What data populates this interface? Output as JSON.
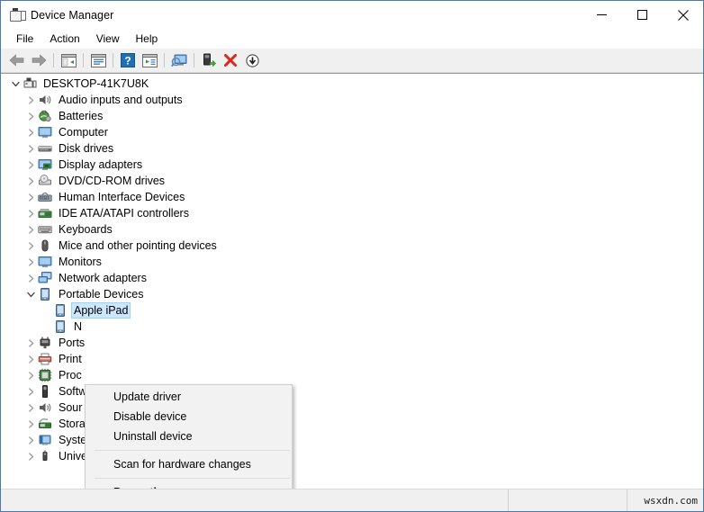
{
  "window": {
    "title": "Device Manager",
    "icon": "device-manager-icon",
    "controls": [
      {
        "name": "minimize-button",
        "glyph": "minimize"
      },
      {
        "name": "maximize-button",
        "glyph": "maximize"
      },
      {
        "name": "close-button",
        "glyph": "close"
      }
    ]
  },
  "menubar": {
    "items": [
      {
        "label": "File"
      },
      {
        "label": "Action"
      },
      {
        "label": "View"
      },
      {
        "label": "Help"
      }
    ]
  },
  "toolbar": {
    "buttons": [
      {
        "name": "back-button",
        "icon": "back-arrow-icon"
      },
      {
        "name": "forward-button",
        "icon": "forward-arrow-icon"
      },
      {
        "name": "separator-1",
        "icon": "separator"
      },
      {
        "name": "show-hide-console-tree-button",
        "icon": "console-tree-icon"
      },
      {
        "name": "separator-2",
        "icon": "separator"
      },
      {
        "name": "properties-button",
        "icon": "properties-icon"
      },
      {
        "name": "separator-3",
        "icon": "separator"
      },
      {
        "name": "help-button",
        "icon": "help-question-icon"
      },
      {
        "name": "show-window-button",
        "icon": "show-window-icon"
      },
      {
        "name": "separator-4",
        "icon": "separator"
      },
      {
        "name": "scan-hardware-changes-button",
        "icon": "scan-monitor-icon"
      },
      {
        "name": "separator-5",
        "icon": "separator"
      },
      {
        "name": "update-driver-button",
        "icon": "update-driver-icon"
      },
      {
        "name": "uninstall-device-button",
        "icon": "red-x-icon"
      },
      {
        "name": "disable-device-button",
        "icon": "down-arrow-circle-icon"
      }
    ]
  },
  "tree": {
    "root": {
      "label": "DESKTOP-41K7U8K",
      "icon": "computer-root-icon",
      "expanded": true,
      "indent": 0
    },
    "nodes": [
      {
        "label": "Audio inputs and outputs",
        "icon": "speaker-icon",
        "expanded": false,
        "indent": 1,
        "selected": false
      },
      {
        "label": "Batteries",
        "icon": "battery-icon",
        "expanded": false,
        "indent": 1,
        "selected": false
      },
      {
        "label": "Computer",
        "icon": "monitor-icon",
        "expanded": false,
        "indent": 1,
        "selected": false
      },
      {
        "label": "Disk drives",
        "icon": "disk-drive-icon",
        "expanded": false,
        "indent": 1,
        "selected": false
      },
      {
        "label": "Display adapters",
        "icon": "display-adapter-icon",
        "expanded": false,
        "indent": 1,
        "selected": false
      },
      {
        "label": "DVD/CD-ROM drives",
        "icon": "dvd-drive-icon",
        "expanded": false,
        "indent": 1,
        "selected": false
      },
      {
        "label": "Human Interface Devices",
        "icon": "hid-icon",
        "expanded": false,
        "indent": 1,
        "selected": false
      },
      {
        "label": "IDE ATA/ATAPI controllers",
        "icon": "ide-controller-icon",
        "expanded": false,
        "indent": 1,
        "selected": false
      },
      {
        "label": "Keyboards",
        "icon": "keyboard-icon",
        "expanded": false,
        "indent": 1,
        "selected": false
      },
      {
        "label": "Mice and other pointing devices",
        "icon": "mouse-icon",
        "expanded": false,
        "indent": 1,
        "selected": false
      },
      {
        "label": "Monitors",
        "icon": "monitor-icon",
        "expanded": false,
        "indent": 1,
        "selected": false
      },
      {
        "label": "Network adapters",
        "icon": "network-adapter-icon",
        "expanded": false,
        "indent": 1,
        "selected": false
      },
      {
        "label": "Portable Devices",
        "icon": "portable-device-icon",
        "expanded": true,
        "indent": 1,
        "selected": false
      },
      {
        "label": "Apple iPad",
        "icon": "portable-device-icon",
        "expanded": null,
        "indent": 2,
        "selected": true
      },
      {
        "label": "N",
        "icon": "portable-device-icon",
        "expanded": null,
        "indent": 2,
        "selected": false
      },
      {
        "label": "Ports",
        "icon": "ports-icon",
        "expanded": false,
        "indent": 1,
        "selected": false
      },
      {
        "label": "Print",
        "icon": "printer-icon",
        "expanded": false,
        "indent": 1,
        "selected": false
      },
      {
        "label": "Proc",
        "icon": "processor-icon",
        "expanded": false,
        "indent": 1,
        "selected": false
      },
      {
        "label": "Softw",
        "icon": "software-device-icon",
        "expanded": false,
        "indent": 1,
        "selected": false
      },
      {
        "label": "Sour",
        "icon": "speaker-icon",
        "expanded": false,
        "indent": 1,
        "selected": false
      },
      {
        "label": "Stora",
        "icon": "storage-controller-icon",
        "expanded": false,
        "indent": 1,
        "selected": false
      },
      {
        "label": "System devices",
        "icon": "system-device-icon",
        "expanded": false,
        "indent": 1,
        "selected": false
      },
      {
        "label": "Universal Serial Bus controllers",
        "icon": "usb-icon",
        "expanded": false,
        "indent": 1,
        "selected": false
      }
    ]
  },
  "context_menu": {
    "items": [
      {
        "label": "Update driver",
        "type": "item",
        "bold": false
      },
      {
        "label": "Disable device",
        "type": "item",
        "bold": false
      },
      {
        "label": "Uninstall device",
        "type": "item",
        "bold": false
      },
      {
        "label": "",
        "type": "separator",
        "bold": false
      },
      {
        "label": "Scan for hardware changes",
        "type": "item",
        "bold": false
      },
      {
        "label": "",
        "type": "separator",
        "bold": false
      },
      {
        "label": "Properties",
        "type": "item",
        "bold": true
      }
    ]
  },
  "statusbar": {
    "pane1": "",
    "pane2": "",
    "watermark": "wsxdn.com"
  },
  "colors": {
    "window_border": "#4a7ba6",
    "toolbar_bg": "#f0f0f0",
    "selection_bg": "#cce8ff",
    "menu_bg": "#f2f2f2",
    "accent_red": "#d52b1e",
    "accent_blue": "#1f6fb4",
    "accent_green": "#4ba82e"
  }
}
